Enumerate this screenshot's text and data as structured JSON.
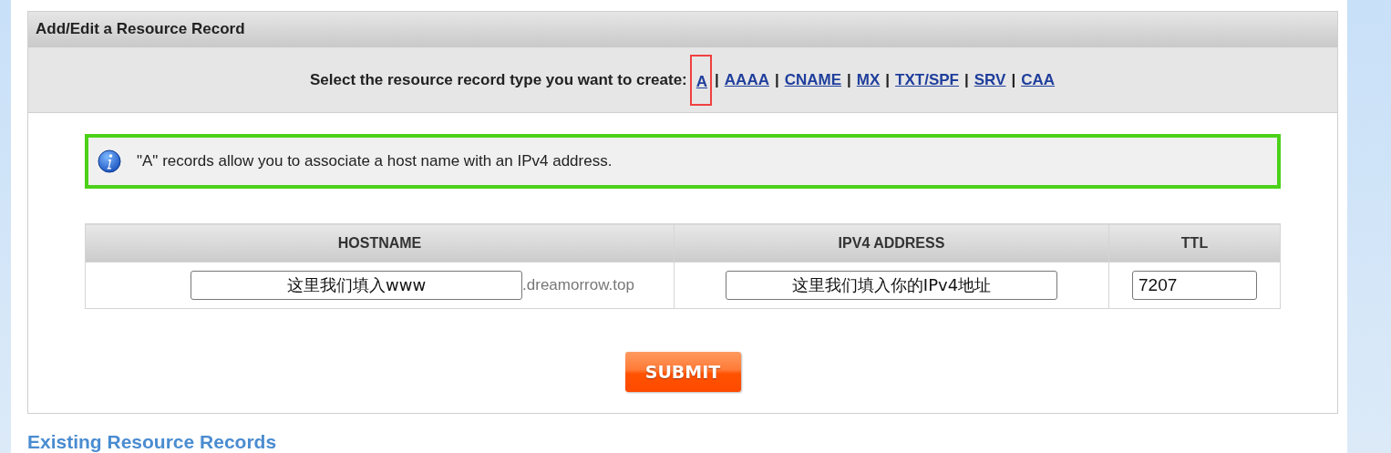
{
  "panel": {
    "title": "Add/Edit a Resource Record"
  },
  "type_selector": {
    "prompt": "Select the resource record type you want to create:",
    "separator": "|",
    "record_types": [
      {
        "label": "A",
        "selected": true
      },
      {
        "label": "AAAA",
        "selected": false
      },
      {
        "label": "CNAME",
        "selected": false
      },
      {
        "label": "MX",
        "selected": false
      },
      {
        "label": "TXT/SPF",
        "selected": false
      },
      {
        "label": "SRV",
        "selected": false
      },
      {
        "label": "CAA",
        "selected": false
      }
    ]
  },
  "info": {
    "text": "\"A\" records allow you to associate a host name with an IPv4 address."
  },
  "table": {
    "columns": [
      "HOSTNAME",
      "IPV4 ADDRESS",
      "TTL"
    ],
    "hostname": {
      "value": "这里我们填入www",
      "suffix": ".dreamorrow.top"
    },
    "ipv4": {
      "value": "这里我们填入你的IPv4地址"
    },
    "ttl": {
      "value": "7207"
    }
  },
  "submit": {
    "label": "SUBMIT"
  },
  "existing": {
    "title": "Existing Resource Records"
  }
}
